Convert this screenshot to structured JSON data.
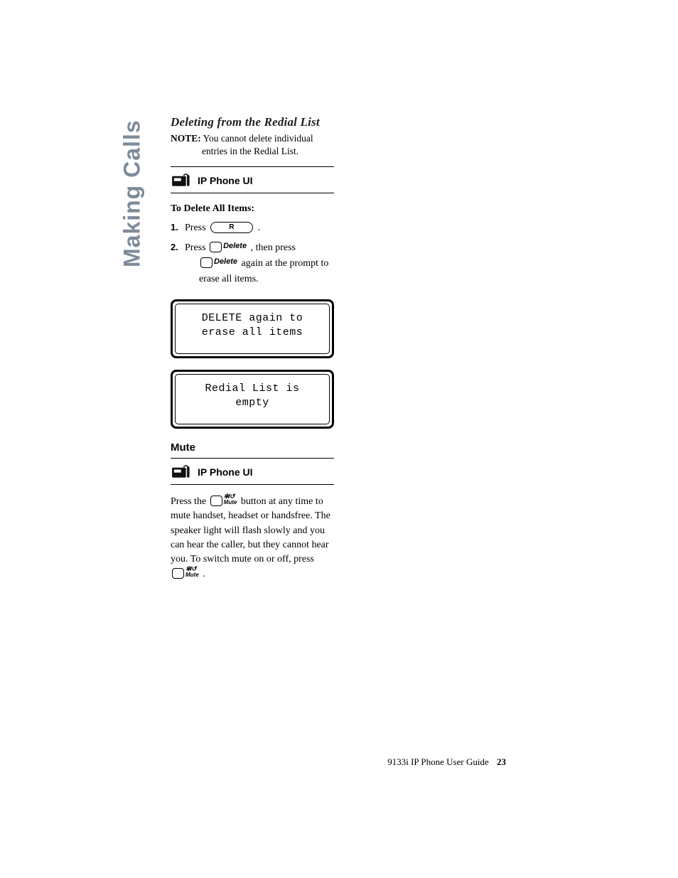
{
  "side_tab": "Making Calls",
  "heading_redial": "Deleting from the Redial List",
  "note_label": "NOTE:",
  "note_line1": "You cannot delete individual",
  "note_line2": "entries in the Redial List.",
  "ip_phone_ui": "IP Phone UI",
  "to_delete_all": "To Delete All Items:",
  "steps": {
    "s1_a": "Press",
    "s1_dot": ".",
    "s2_a": "Press",
    "s2_b": ", then press",
    "s2_c": "again at the prompt to",
    "s2_d": "erase all items."
  },
  "btn_redial": "R",
  "btn_delete": "Delete",
  "btn_mute_top": "✻/↺",
  "btn_mute_bottom": "Mute",
  "lcd1_line1": "DELETE again to",
  "lcd1_line2": "erase all items",
  "lcd2_line1": "Redial List is",
  "lcd2_line2": "empty",
  "heading_mute": "Mute",
  "mute_p_a": "Press the",
  "mute_p_b": "button at any time to mute handset, headset or handsfree. The speaker light will flash slowly and you can hear the caller, but they cannot hear you. To switch mute on or off, press",
  "mute_p_dot": ".",
  "footer_title": "9133i IP Phone User Guide",
  "footer_page": "23"
}
